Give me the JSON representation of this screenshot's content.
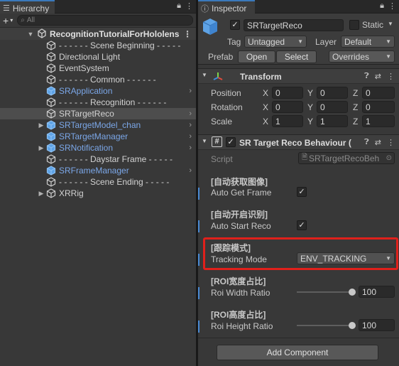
{
  "hierarchy": {
    "tab_label": "Hierarchy",
    "search_placeholder": "All",
    "scene_name": "RecognitionTutorialForHololens",
    "items": [
      {
        "label": "- - - - - - Scene Beginning - - - - -",
        "blue": false
      },
      {
        "label": "Directional Light",
        "blue": false
      },
      {
        "label": "EventSystem",
        "blue": false
      },
      {
        "label": "- - - - - - Common - - - - - -",
        "blue": false
      },
      {
        "label": "SRApplication",
        "blue": true
      },
      {
        "label": "- - - - - - Recognition - - - - - -",
        "blue": false
      },
      {
        "label": "SRTargetReco",
        "blue": false
      },
      {
        "label": "SRTargetModel_chan",
        "blue": true
      },
      {
        "label": "SRTargetManager",
        "blue": true
      },
      {
        "label": "SRNotification",
        "blue": true
      },
      {
        "label": "- - - - - - Daystar Frame - - - - -",
        "blue": false
      },
      {
        "label": "SRFrameManager",
        "blue": true
      },
      {
        "label": "- - - - - - Scene Ending - - - - -",
        "blue": false
      },
      {
        "label": "XRRig",
        "blue": false
      }
    ]
  },
  "inspector": {
    "tab_label": "Inspector",
    "object_name": "SRTargetReco",
    "static_label": "Static",
    "tag_label": "Tag",
    "tag_value": "Untagged",
    "layer_label": "Layer",
    "layer_value": "Default",
    "prefab_label": "Prefab",
    "open_label": "Open",
    "select_label": "Select",
    "overrides_label": "Overrides",
    "transform": {
      "title": "Transform",
      "position_label": "Position",
      "rotation_label": "Rotation",
      "scale_label": "Scale",
      "x_label": "X",
      "y_label": "Y",
      "z_label": "Z",
      "position": [
        "0",
        "0",
        "0"
      ],
      "rotation": [
        "0",
        "0",
        "0"
      ],
      "scale": [
        "1",
        "1",
        "1"
      ]
    },
    "behaviour": {
      "title": "SR Target Reco Behaviour (",
      "script_label": "Script",
      "script_value": "SRTargetRecoBeh",
      "auto_get_frame_header": "[自动获取图像]",
      "auto_get_frame_label": "Auto Get Frame",
      "auto_start_reco_header": "[自动开启识别]",
      "auto_start_reco_label": "Auto Start Reco",
      "tracking_header": "[跟踪模式]",
      "tracking_label": "Tracking Mode",
      "tracking_value": "ENV_TRACKING",
      "roi_width_header": "[ROI宽度占比]",
      "roi_width_label": "Roi Width Ratio",
      "roi_width_value": "100",
      "roi_height_header": "[ROI高度占比]",
      "roi_height_label": "Roi Height Ratio",
      "roi_height_value": "100"
    },
    "add_component_label": "Add Component"
  },
  "colors": {
    "highlight": "#e0201b",
    "prefab_blue": "#7ba7e8",
    "accent": "#3a79bb"
  }
}
